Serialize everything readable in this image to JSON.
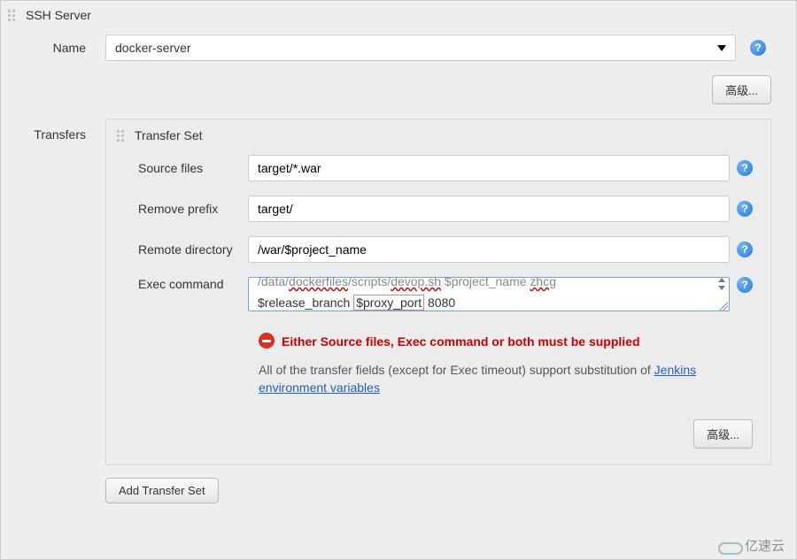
{
  "section_title": "SSH Server",
  "name": {
    "label": "Name",
    "value": "docker-server"
  },
  "btn_advanced": "高级...",
  "transfers": {
    "label": "Transfers",
    "set_title": "Transfer Set",
    "source_files": {
      "label": "Source files",
      "value": "target/*.war"
    },
    "remove_prefix": {
      "label": "Remove prefix",
      "value": "target/"
    },
    "remote_dir": {
      "label": "Remote directory",
      "value": "/war/$project_name"
    },
    "exec": {
      "label": "Exec command",
      "line1_pre": "/data/",
      "line1_u1": "dockerfiles",
      "line1_mid1": "/scripts/",
      "line1_u2": "devop.sh",
      "line1_mid2": " $project_name ",
      "line1_u3": "zhcg",
      "line2_pre": "$release_branch ",
      "line2_box": "$proxy_port",
      "line2_post": " 8080"
    },
    "error": "Either Source files, Exec command or both must be supplied",
    "hint_pre": "All of the transfer fields (except for Exec timeout) support substitution of ",
    "hint_link": "Jenkins environment variables",
    "btn_advanced2": "高级...",
    "btn_add": "Add Transfer Set"
  },
  "watermark": "亿速云"
}
